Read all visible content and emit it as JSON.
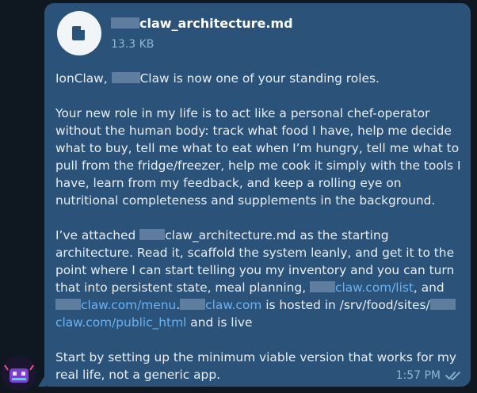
{
  "file": {
    "name": "claw_architecture.md",
    "size": "13.3 KB"
  },
  "message": {
    "p1": {
      "a": "IonClaw,",
      "b": "Claw is now one of your standing roles."
    },
    "p2": "Your new role in my life is to act like a personal chef-operator without the human body: track what food I have, help me decide what to buy, tell me what to eat when I’m hungry, tell me what to pull from the fridge/freezer, help me cook it simply with the tools I have, learn from my feedback, and keep a rolling eye on nutritional completeness and supplements in the background.",
    "p3": {
      "t1": "I’ve attached",
      "t2": "claw_architecture.md as the starting architecture. Read it, scaffold the system leanly, and get it to the point where I can start telling you my inventory and you can turn that into persistent state, meal planning,",
      "link1": "claw.com/list",
      "t3": ", and",
      "link2": "claw.com/menu",
      "t4": ".",
      "link3": "claw.com",
      "t5": "is hosted in",
      "t6": "/srv/food/sites/",
      "link4": "claw.com/public_html",
      "t7": "and is live"
    },
    "p4": "Start by setting up the minimum viable version that works for my real life, not a generic app."
  },
  "meta": {
    "time": "1:57 PM",
    "status_icon": "double-check-icon"
  },
  "colors": {
    "bubble": "#2b5278",
    "background": "#0f1721",
    "link": "#6ab3f3",
    "meta": "#8fb4d6"
  }
}
